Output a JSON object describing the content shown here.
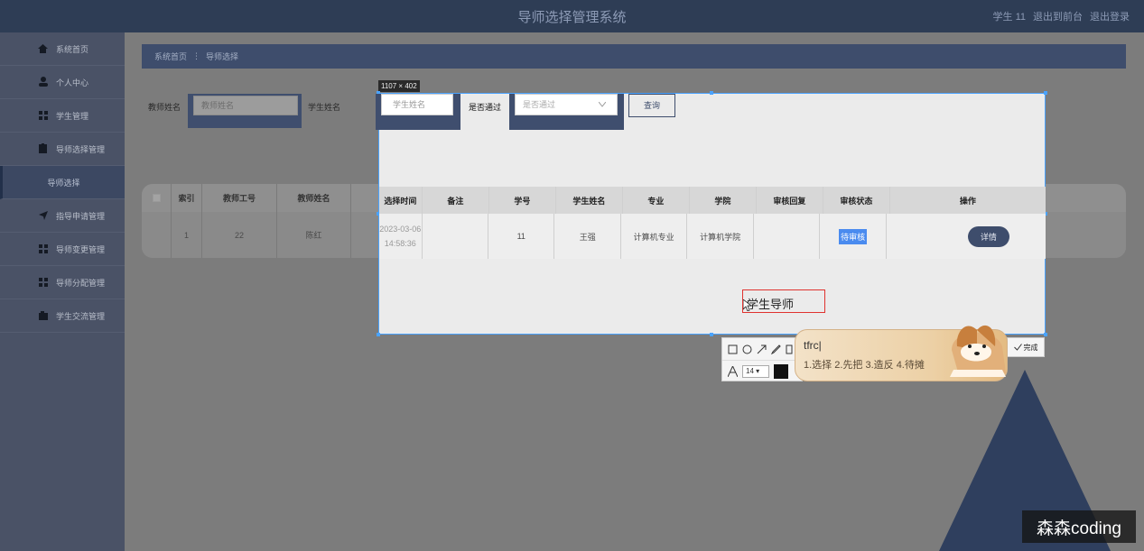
{
  "header": {
    "title": "导师选择管理系统",
    "user": "学生 11",
    "back_label": "退出到前台",
    "logout_label": "退出登录"
  },
  "sidebar": {
    "items": [
      {
        "label": "系统首页",
        "icon": "home-icon"
      },
      {
        "label": "个人中心",
        "icon": "user-icon"
      },
      {
        "label": "学生管理",
        "icon": "grid-icon"
      },
      {
        "label": "导师选择管理",
        "icon": "clipboard-icon"
      },
      {
        "label": "导师选择",
        "icon": ""
      },
      {
        "label": "指导申请管理",
        "icon": "send-icon"
      },
      {
        "label": "导师变更管理",
        "icon": "grid-icon"
      },
      {
        "label": "导师分配管理",
        "icon": "grid-icon"
      },
      {
        "label": "学生交流管理",
        "icon": "chat-icon"
      }
    ]
  },
  "breadcrumb": {
    "home": "系统首页",
    "separator": "⋮",
    "current": "导师选择"
  },
  "search": {
    "teacher_label": "教师姓名",
    "teacher_placeholder": "教师姓名",
    "student_label": "学生姓名",
    "student_placeholder": "学生姓名",
    "pass_label": "是否通过",
    "pass_placeholder": "是否通过",
    "query_label": "查询"
  },
  "table": {
    "headers": [
      "索引",
      "教师工号",
      "教师姓名",
      "选择时间",
      "备注",
      "学号",
      "学生姓名",
      "专业",
      "学院",
      "审核回复",
      "审核状态",
      "操作"
    ],
    "rows": [
      {
        "index": "1",
        "teacher_no": "22",
        "teacher_name": "陈红",
        "time": "2023-03-06 14:58:36",
        "note": "",
        "student_no": "11",
        "student_name": "王强",
        "major": "计算机专业",
        "college": "计算机学院",
        "reply": "",
        "status": "待审核",
        "action": "详情"
      }
    ]
  },
  "screenshot_tool": {
    "size_tag": "1107 × 402",
    "text_entry": "学生导师",
    "font_size": "14",
    "done_label": "完成",
    "color": "#111111"
  },
  "ime": {
    "composition": "tfrc|",
    "candidates": "1.选择  2.先把  3.造反  4.待摊"
  },
  "watermark": "森森coding",
  "colors": {
    "header_bg": "#2e3d55",
    "accent": "#3e4d6c",
    "selection": "#4aa3ff",
    "pending_badge": "#4a8bef"
  }
}
